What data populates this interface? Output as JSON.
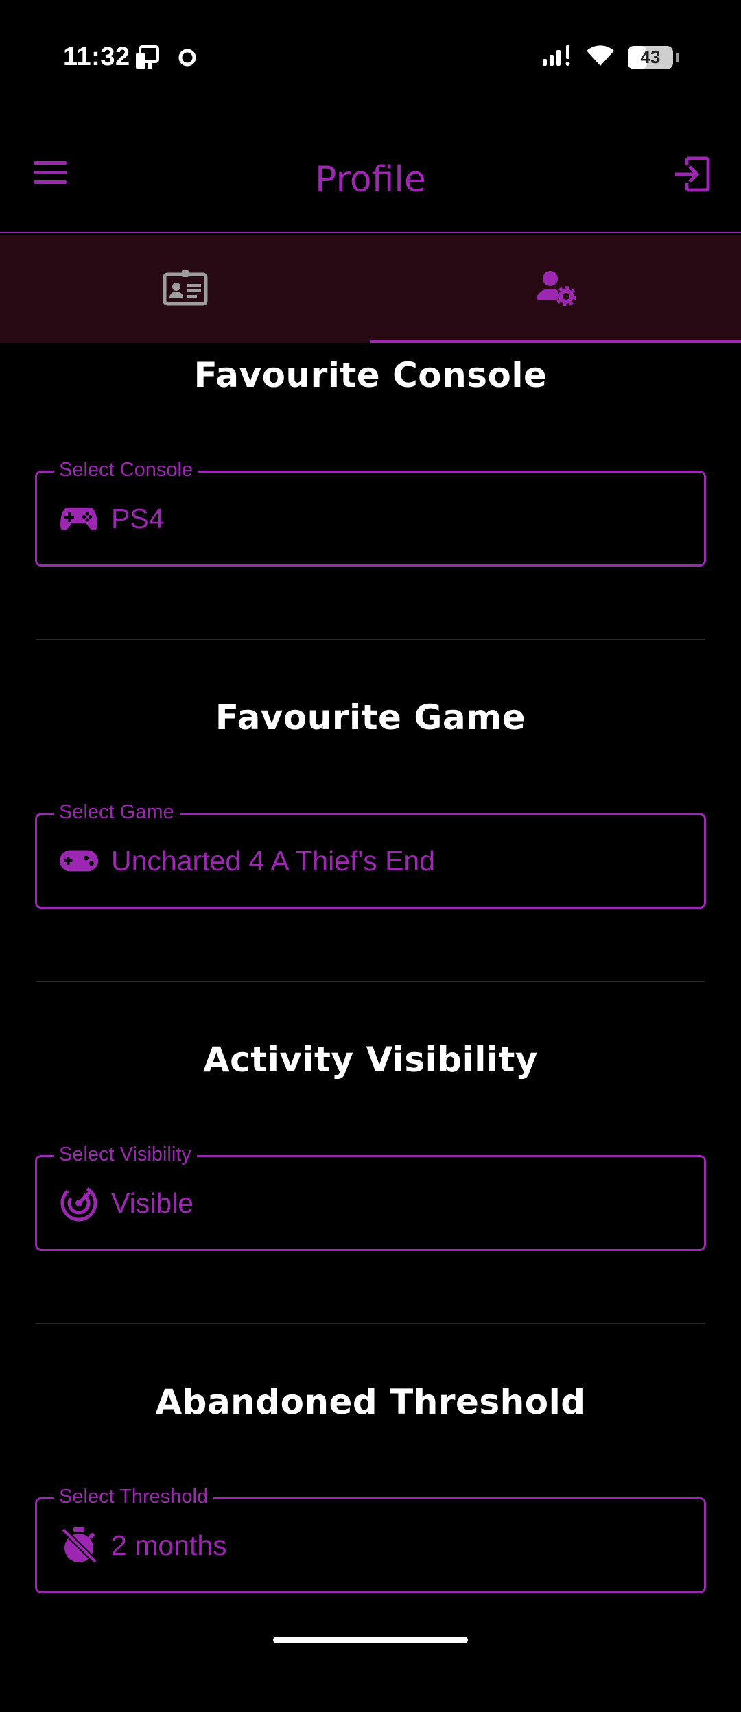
{
  "status_bar": {
    "time": "11:32",
    "battery": "43",
    "battery_level": 0.43
  },
  "app_bar": {
    "title": "Profile",
    "menu_icon": "menu-icon",
    "logout_icon": "logout-icon"
  },
  "tabs": [
    {
      "icon": "id-card-icon",
      "selected": false
    },
    {
      "icon": "user-settings-icon",
      "selected": true
    }
  ],
  "sections": [
    {
      "title": "Favourite Console",
      "field_label": "Select Console",
      "value": "PS4",
      "icon": "gamepad-icon"
    },
    {
      "title": "Favourite Game",
      "field_label": "Select Game",
      "value": "Uncharted 4 A Thief's End",
      "icon": "controller-icon"
    },
    {
      "title": "Activity Visibility",
      "field_label": "Select Visibility",
      "value": "Visible",
      "icon": "radar-icon"
    },
    {
      "title": "Abandoned Threshold",
      "field_label": "Select Threshold",
      "value": "2 months",
      "icon": "timer-off-icon"
    }
  ],
  "colors": {
    "accent": "#9c27b0",
    "background": "#000000",
    "tab_bar": "#270a14",
    "tab_inactive": "#9e9e9e"
  }
}
